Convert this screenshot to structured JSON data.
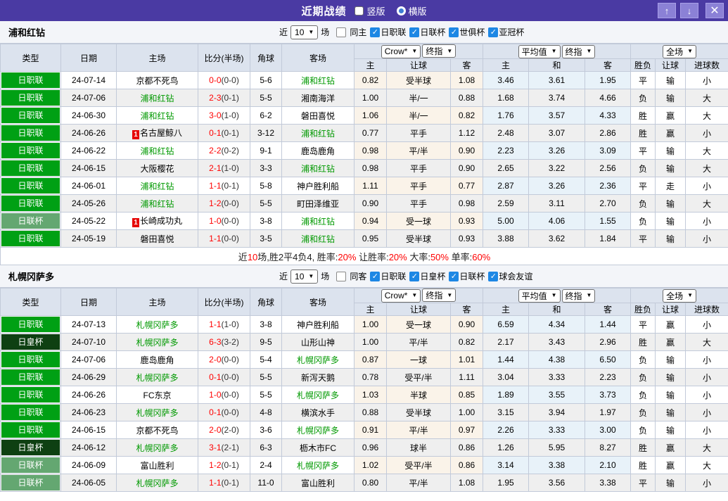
{
  "titlebar": {
    "title": "近期战绩",
    "radios": [
      {
        "label": "竖版",
        "selected": true
      },
      {
        "label": "横版",
        "selected": false
      }
    ]
  },
  "icons": {
    "arrow_up": "↑",
    "arrow_down": "↓",
    "close": "✕",
    "check": "✓",
    "chevron_down": "▼"
  },
  "colors": {
    "titlebar_bg": "#4a3aa3",
    "checkbox_blue": "#1d87e4",
    "win_red": "#e60000",
    "lose_blue": "#2e2ed2",
    "draw_green": "#009900",
    "score_red": "#ff0000",
    "focus_team_green": "#009900"
  },
  "league_colors": {
    "日职联": "#00a014",
    "日联杯": "#64a771",
    "日皇杯": "#0e4012"
  },
  "result_colors": {
    "胜": "red",
    "平": "green",
    "负": "blue",
    "赢": "red",
    "输": "blue",
    "走": "green",
    "大": "red",
    "小": "blue"
  },
  "table_headers": {
    "type": "类型",
    "date": "日期",
    "home": "主场",
    "score": "比分(半场)",
    "corner": "角球",
    "away": "客场",
    "selects": {
      "company": "Crow*",
      "stage": "终指",
      "average": "平均值",
      "stage2": "终指",
      "scope": "全场"
    },
    "sub": [
      "主",
      "让球",
      "客",
      "主",
      "和",
      "客",
      "胜负",
      "让球",
      "进球数"
    ]
  },
  "sections": [
    {
      "team": "浦和红钻",
      "filter": {
        "near_label": "近",
        "count": "10",
        "games_label": "场",
        "same_label": "同主",
        "same_checked": false,
        "leagues": [
          "日职联",
          "日联杯",
          "世俱杯",
          "亚冠杯"
        ]
      },
      "rows": [
        {
          "league": "日职联",
          "date": "24-07-14",
          "home": "京都不死鸟",
          "home_focus": false,
          "home_card": "",
          "score": "0-0",
          "half": "(0-0)",
          "corner": "5-6",
          "away": "浦和红钻",
          "away_focus": true,
          "odds": [
            "0.82",
            "受半球",
            "1.08"
          ],
          "avg": [
            "3.46",
            "3.61",
            "1.95"
          ],
          "res": "平",
          "hres": "输",
          "goals": "小"
        },
        {
          "league": "日职联",
          "date": "24-07-06",
          "home": "浦和红钻",
          "home_focus": true,
          "home_card": "",
          "score": "2-3",
          "half": "(0-1)",
          "corner": "5-5",
          "away": "湘南海洋",
          "away_focus": false,
          "odds": [
            "1.00",
            "半/一",
            "0.88"
          ],
          "avg": [
            "1.68",
            "3.74",
            "4.66"
          ],
          "res": "负",
          "hres": "输",
          "goals": "大"
        },
        {
          "league": "日职联",
          "date": "24-06-30",
          "home": "浦和红钻",
          "home_focus": true,
          "home_card": "",
          "score": "3-0",
          "half": "(1-0)",
          "corner": "6-2",
          "away": "磐田喜悦",
          "away_focus": false,
          "odds": [
            "1.06",
            "半/一",
            "0.82"
          ],
          "avg": [
            "1.76",
            "3.57",
            "4.33"
          ],
          "res": "胜",
          "hres": "赢",
          "goals": "大"
        },
        {
          "league": "日职联",
          "date": "24-06-26",
          "home": "名古屋鲸八",
          "home_focus": false,
          "home_card": "1",
          "score": "0-1",
          "half": "(0-1)",
          "corner": "3-12",
          "away": "浦和红钻",
          "away_focus": true,
          "odds": [
            "0.77",
            "平手",
            "1.12"
          ],
          "avg": [
            "2.48",
            "3.07",
            "2.86"
          ],
          "res": "胜",
          "hres": "赢",
          "goals": "小"
        },
        {
          "league": "日职联",
          "date": "24-06-22",
          "home": "浦和红钻",
          "home_focus": true,
          "home_card": "",
          "score": "2-2",
          "half": "(0-2)",
          "corner": "9-1",
          "away": "鹿岛鹿角",
          "away_focus": false,
          "odds": [
            "0.98",
            "平/半",
            "0.90"
          ],
          "avg": [
            "2.23",
            "3.26",
            "3.09"
          ],
          "res": "平",
          "hres": "输",
          "goals": "大"
        },
        {
          "league": "日职联",
          "date": "24-06-15",
          "home": "大阪樱花",
          "home_focus": false,
          "home_card": "",
          "score": "2-1",
          "half": "(1-0)",
          "corner": "3-3",
          "away": "浦和红钻",
          "away_focus": true,
          "odds": [
            "0.98",
            "平手",
            "0.90"
          ],
          "avg": [
            "2.65",
            "3.22",
            "2.56"
          ],
          "res": "负",
          "hres": "输",
          "goals": "大"
        },
        {
          "league": "日职联",
          "date": "24-06-01",
          "home": "浦和红钻",
          "home_focus": true,
          "home_card": "",
          "score": "1-1",
          "half": "(0-1)",
          "corner": "5-8",
          "away": "神户胜利船",
          "away_focus": false,
          "odds": [
            "1.11",
            "平手",
            "0.77"
          ],
          "avg": [
            "2.87",
            "3.26",
            "2.36"
          ],
          "res": "平",
          "hres": "走",
          "goals": "小"
        },
        {
          "league": "日职联",
          "date": "24-05-26",
          "home": "浦和红钻",
          "home_focus": true,
          "home_card": "",
          "score": "1-2",
          "half": "(0-0)",
          "corner": "5-5",
          "away": "町田泽维亚",
          "away_focus": false,
          "odds": [
            "0.90",
            "平手",
            "0.98"
          ],
          "avg": [
            "2.59",
            "3.11",
            "2.70"
          ],
          "res": "负",
          "hres": "输",
          "goals": "大"
        },
        {
          "league": "日联杯",
          "date": "24-05-22",
          "home": "长崎成功丸",
          "home_focus": false,
          "home_card": "1",
          "score": "1-0",
          "half": "(0-0)",
          "corner": "3-8",
          "away": "浦和红钻",
          "away_focus": true,
          "odds": [
            "0.94",
            "受一球",
            "0.93"
          ],
          "avg": [
            "5.00",
            "4.06",
            "1.55"
          ],
          "res": "负",
          "hres": "输",
          "goals": "小"
        },
        {
          "league": "日职联",
          "date": "24-05-19",
          "home": "磐田喜悦",
          "home_focus": false,
          "home_card": "",
          "score": "1-1",
          "half": "(0-0)",
          "corner": "3-5",
          "away": "浦和红钻",
          "away_focus": true,
          "odds": [
            "0.95",
            "受半球",
            "0.93"
          ],
          "avg": [
            "3.88",
            "3.62",
            "1.84"
          ],
          "res": "平",
          "hres": "输",
          "goals": "小"
        }
      ],
      "summary": [
        {
          "t": "近",
          "c": "k"
        },
        {
          "t": "10",
          "c": "r"
        },
        {
          "t": "场,胜2平4负4, 胜率:",
          "c": "k"
        },
        {
          "t": "20%",
          "c": "r"
        },
        {
          "t": " 让胜率:",
          "c": "k"
        },
        {
          "t": "20%",
          "c": "r"
        },
        {
          "t": " 大率:",
          "c": "k"
        },
        {
          "t": "50%",
          "c": "r"
        },
        {
          "t": " 单率:",
          "c": "k"
        },
        {
          "t": "60%",
          "c": "r"
        }
      ]
    },
    {
      "team": "札幌冈萨多",
      "filter": {
        "near_label": "近",
        "count": "10",
        "games_label": "场",
        "same_label": "同客",
        "same_checked": false,
        "leagues": [
          "日职联",
          "日皇杯",
          "日联杯",
          "球会友谊"
        ]
      },
      "rows": [
        {
          "league": "日职联",
          "date": "24-07-13",
          "home": "札幌冈萨多",
          "home_focus": true,
          "home_card": "",
          "score": "1-1",
          "half": "(1-0)",
          "corner": "3-8",
          "away": "神户胜利船",
          "away_focus": false,
          "odds": [
            "1.00",
            "受一球",
            "0.90"
          ],
          "avg": [
            "6.59",
            "4.34",
            "1.44"
          ],
          "res": "平",
          "hres": "赢",
          "goals": "小"
        },
        {
          "league": "日皇杯",
          "date": "24-07-10",
          "home": "札幌冈萨多",
          "home_focus": true,
          "home_card": "",
          "score": "6-3",
          "half": "(3-2)",
          "corner": "9-5",
          "away": "山形山神",
          "away_focus": false,
          "odds": [
            "1.00",
            "平/半",
            "0.82"
          ],
          "avg": [
            "2.17",
            "3.43",
            "2.96"
          ],
          "res": "胜",
          "hres": "赢",
          "goals": "大"
        },
        {
          "league": "日职联",
          "date": "24-07-06",
          "home": "鹿岛鹿角",
          "home_focus": false,
          "home_card": "",
          "score": "2-0",
          "half": "(0-0)",
          "corner": "5-4",
          "away": "札幌冈萨多",
          "away_focus": true,
          "odds": [
            "0.87",
            "一球",
            "1.01"
          ],
          "avg": [
            "1.44",
            "4.38",
            "6.50"
          ],
          "res": "负",
          "hres": "输",
          "goals": "小"
        },
        {
          "league": "日职联",
          "date": "24-06-29",
          "home": "札幌冈萨多",
          "home_focus": true,
          "home_card": "",
          "score": "0-1",
          "half": "(0-0)",
          "corner": "5-5",
          "away": "新泻天鹅",
          "away_focus": false,
          "odds": [
            "0.78",
            "受平/半",
            "1.11"
          ],
          "avg": [
            "3.04",
            "3.33",
            "2.23"
          ],
          "res": "负",
          "hres": "输",
          "goals": "小"
        },
        {
          "league": "日职联",
          "date": "24-06-26",
          "home": "FC东京",
          "home_focus": false,
          "home_card": "",
          "score": "1-0",
          "half": "(0-0)",
          "corner": "5-5",
          "away": "札幌冈萨多",
          "away_focus": true,
          "odds": [
            "1.03",
            "半球",
            "0.85"
          ],
          "avg": [
            "1.89",
            "3.55",
            "3.73"
          ],
          "res": "负",
          "hres": "输",
          "goals": "小"
        },
        {
          "league": "日职联",
          "date": "24-06-23",
          "home": "札幌冈萨多",
          "home_focus": true,
          "home_card": "",
          "score": "0-1",
          "half": "(0-0)",
          "corner": "4-8",
          "away": "横滨水手",
          "away_focus": false,
          "odds": [
            "0.88",
            "受半球",
            "1.00"
          ],
          "avg": [
            "3.15",
            "3.94",
            "1.97"
          ],
          "res": "负",
          "hres": "输",
          "goals": "小"
        },
        {
          "league": "日职联",
          "date": "24-06-15",
          "home": "京都不死鸟",
          "home_focus": false,
          "home_card": "",
          "score": "2-0",
          "half": "(2-0)",
          "corner": "3-6",
          "away": "札幌冈萨多",
          "away_focus": true,
          "odds": [
            "0.91",
            "平/半",
            "0.97"
          ],
          "avg": [
            "2.26",
            "3.33",
            "3.00"
          ],
          "res": "负",
          "hres": "输",
          "goals": "小"
        },
        {
          "league": "日皇杯",
          "date": "24-06-12",
          "home": "札幌冈萨多",
          "home_focus": true,
          "home_card": "",
          "score": "3-1",
          "half": "(2-1)",
          "corner": "6-3",
          "away": "枥木市FC",
          "away_focus": false,
          "odds": [
            "0.96",
            "球半",
            "0.86"
          ],
          "avg": [
            "1.26",
            "5.95",
            "8.27"
          ],
          "res": "胜",
          "hres": "赢",
          "goals": "大"
        },
        {
          "league": "日联杯",
          "date": "24-06-09",
          "home": "富山胜利",
          "home_focus": false,
          "home_card": "",
          "score": "1-2",
          "half": "(0-1)",
          "corner": "2-4",
          "away": "札幌冈萨多",
          "away_focus": true,
          "odds": [
            "1.02",
            "受平/半",
            "0.86"
          ],
          "avg": [
            "3.14",
            "3.38",
            "2.10"
          ],
          "res": "胜",
          "hres": "赢",
          "goals": "大"
        },
        {
          "league": "日联杯",
          "date": "24-06-05",
          "home": "札幌冈萨多",
          "home_focus": true,
          "home_card": "",
          "score": "1-1",
          "half": "(0-1)",
          "corner": "11-0",
          "away": "富山胜利",
          "away_focus": false,
          "odds": [
            "0.80",
            "平/半",
            "1.08"
          ],
          "avg": [
            "1.95",
            "3.56",
            "3.38"
          ],
          "res": "平",
          "hres": "输",
          "goals": "小"
        }
      ],
      "summary": null
    }
  ]
}
